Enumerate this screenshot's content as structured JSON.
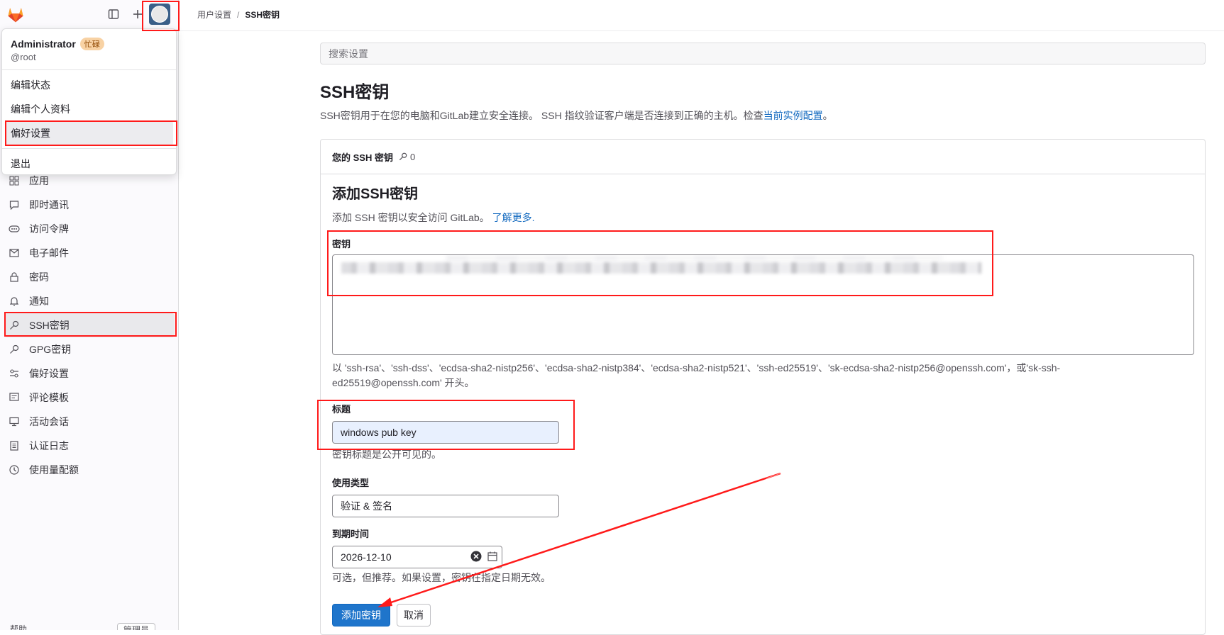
{
  "breadcrumb": {
    "parent": "用户设置",
    "separator": "/",
    "current": "SSH密钥"
  },
  "user_menu": {
    "name": "Administrator",
    "status_badge": "忙碌",
    "handle": "@root",
    "items": [
      "编辑状态",
      "编辑个人资料",
      "偏好设置"
    ],
    "signout": "退出"
  },
  "sidebar": {
    "items": [
      {
        "label": "应用",
        "icon": "apps-icon"
      },
      {
        "label": "即时通讯",
        "icon": "chat-icon"
      },
      {
        "label": "访问令牌",
        "icon": "token-icon"
      },
      {
        "label": "电子邮件",
        "icon": "mail-icon"
      },
      {
        "label": "密码",
        "icon": "lock-icon"
      },
      {
        "label": "通知",
        "icon": "bell-icon"
      },
      {
        "label": "SSH密钥",
        "icon": "key-icon"
      },
      {
        "label": "GPG密钥",
        "icon": "key-icon"
      },
      {
        "label": "偏好设置",
        "icon": "preferences-icon"
      },
      {
        "label": "评论模板",
        "icon": "comment-template-icon"
      },
      {
        "label": "活动会话",
        "icon": "monitor-icon"
      },
      {
        "label": "认证日志",
        "icon": "log-icon"
      },
      {
        "label": "使用量配额",
        "icon": "quota-icon"
      }
    ],
    "help": "帮助",
    "admin": "管理员"
  },
  "search": {
    "placeholder": "搜索设置"
  },
  "page": {
    "title": "SSH密钥",
    "description": "SSH密钥用于在您的电脑和GitLab建立安全连接。 SSH 指纹验证客户端是否连接到正确的主机。检查",
    "description_link": "当前实例配置",
    "description_end": "。"
  },
  "card": {
    "header": "您的 SSH 密钥",
    "key_count": "0",
    "form_title": "添加SSH密钥",
    "form_desc": "添加 SSH 密钥以安全访问 GitLab。",
    "form_link": "了解更多.",
    "key_label": "密钥",
    "key_help_line1": "以 'ssh-rsa'、'ssh-dss'、'ecdsa-sha2-nistp256'、'ecdsa-sha2-nistp384'、'ecdsa-sha2-nistp521'、'ssh-ed25519'、'sk-ecdsa-sha2-nistp256@openssh.com'，或'sk-ssh-",
    "key_help_line2": "ed25519@openssh.com' 开头。",
    "title_label": "标题",
    "title_value": "windows pub key",
    "title_help": "密钥标题是公开可见的。",
    "usage_label": "使用类型",
    "usage_value": "验证 & 签名",
    "expiry_label": "到期时间",
    "expiry_value": "2026-12-10",
    "expiry_help": "可选，但推荐。如果设置，密钥在指定日期无效。",
    "submit": "添加密钥",
    "cancel": "取消"
  },
  "colors": {
    "annotation": "#ff1a1a",
    "primary": "#1f75cb",
    "link": "#1068bf"
  }
}
